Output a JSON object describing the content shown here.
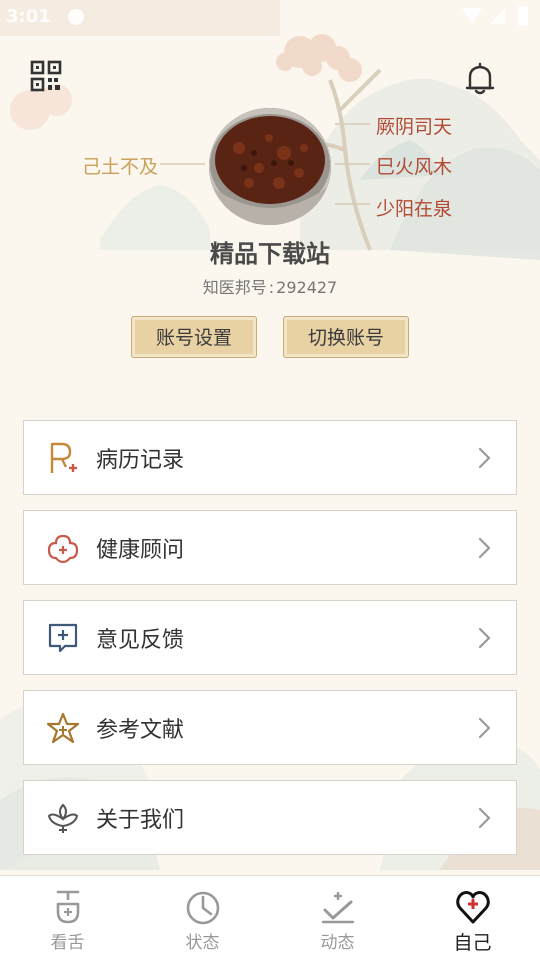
{
  "status_bar": {
    "time": "3:01"
  },
  "header": {
    "qr_icon": "qr-code-icon",
    "bell_icon": "bell-icon"
  },
  "profile": {
    "qi_left": "己土不及",
    "qi_right": [
      "厥阴司天",
      "巳火风木",
      "少阳在泉"
    ],
    "username": "精品下载站",
    "id_label": "知医邦号",
    "id_sep": ":",
    "id_value": "292427",
    "buttons": {
      "account_settings": "账号设置",
      "switch_account": "切换账号"
    }
  },
  "menu": [
    {
      "label": "病历记录",
      "icon": "medical-record-icon",
      "color": "#c4893a"
    },
    {
      "label": "健康顾问",
      "icon": "health-advisor-icon",
      "color": "#c95a4a"
    },
    {
      "label": "意见反馈",
      "icon": "feedback-icon",
      "color": "#3e5a78"
    },
    {
      "label": "参考文献",
      "icon": "star-reference-icon",
      "color": "#a8762e"
    },
    {
      "label": "关于我们",
      "icon": "about-lotus-icon",
      "color": "#555555"
    }
  ],
  "tabs": [
    {
      "label": "看舌",
      "icon": "tongue-icon",
      "active": false
    },
    {
      "label": "状态",
      "icon": "status-clock-icon",
      "active": false
    },
    {
      "label": "动态",
      "icon": "activity-check-icon",
      "active": false
    },
    {
      "label": "自己",
      "icon": "heart-cross-icon",
      "active": true
    }
  ],
  "colors": {
    "background": "#fbf6ee",
    "accent_gold": "#e8d2a4",
    "qi_red": "#b24a34",
    "qi_gold": "#c9a15a"
  }
}
